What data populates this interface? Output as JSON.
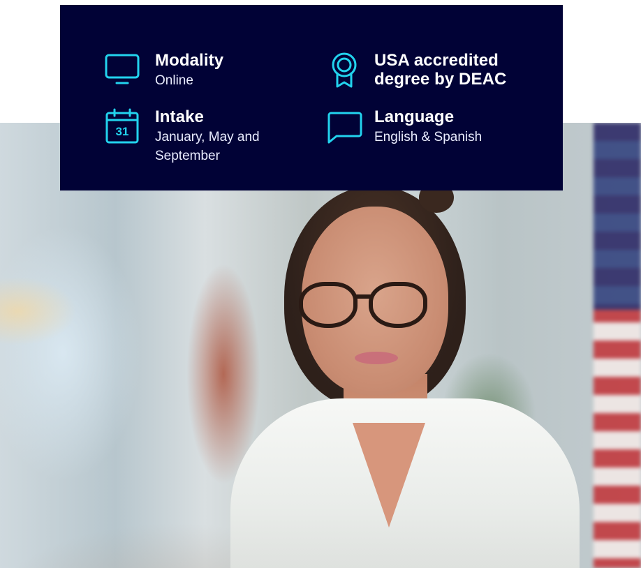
{
  "info_panel": {
    "items": [
      {
        "icon": "monitor-icon",
        "title": "Modality",
        "detail": "Online"
      },
      {
        "icon": "calendar-icon",
        "title": "Intake",
        "detail": "January, May and September",
        "calendar_number": "31"
      },
      {
        "icon": "award-ribbon-icon",
        "title": "USA accredited degree by DEAC",
        "detail": ""
      },
      {
        "icon": "chat-bubble-icon",
        "title": "Language",
        "detail": "English & Spanish"
      }
    ]
  },
  "colors": {
    "panel_background": "#010236",
    "icon_accent": "#22D3EE",
    "text": "#FFFFFF"
  }
}
